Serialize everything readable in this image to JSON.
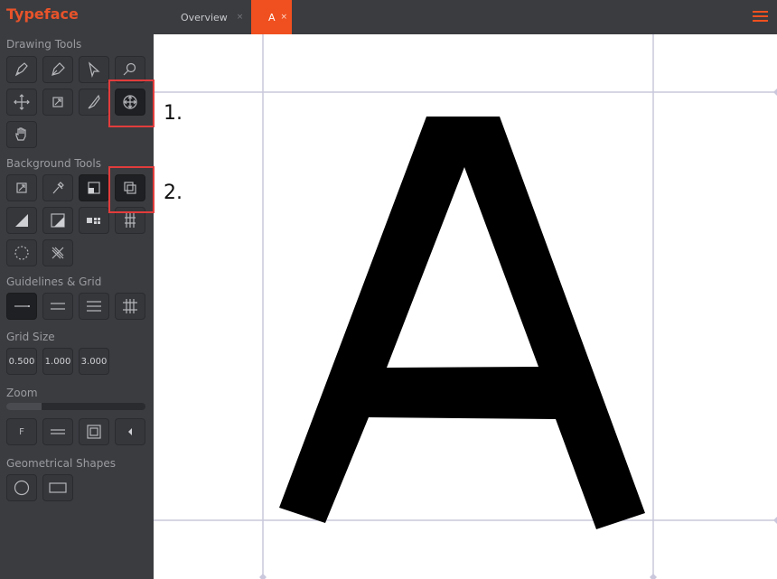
{
  "app": {
    "title": "Typeface"
  },
  "tabs": [
    {
      "label": "Overview",
      "close": "×"
    },
    {
      "label": "A",
      "close": "×"
    }
  ],
  "sidebar": {
    "drawing_tools_title": "Drawing Tools",
    "background_tools_title": "Background Tools",
    "guidelines_title": "Guidelines & Grid",
    "grid_size_title": "Grid Size",
    "grid_sizes": [
      "0.500",
      "1.000",
      "3.000"
    ],
    "zoom_title": "Zoom",
    "zoom_level": 0.25,
    "zoom_buttons": {
      "fit_label": "F"
    },
    "shapes_title": "Geometrical Shapes"
  },
  "canvas": {
    "glyph": "A"
  },
  "annotations": [
    "1.",
    "2."
  ],
  "colors": {
    "accent": "#f0501f",
    "sidebar": "#3b3c40",
    "highlight": "#e23c3c"
  }
}
